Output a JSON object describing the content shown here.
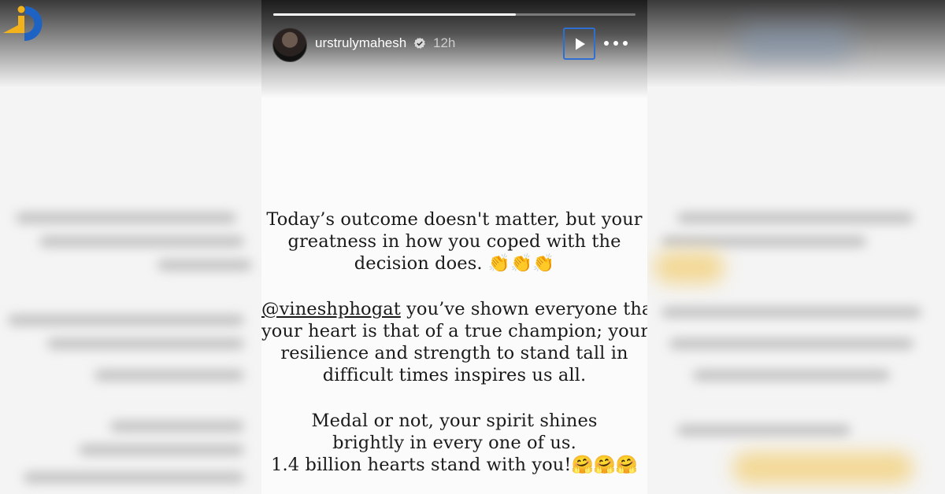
{
  "story": {
    "username": "urstrulymahesh",
    "timestamp": "12h",
    "progress": 0.67,
    "paragraph1": [
      "Today’s outcome doesn't matter, but your",
      "greatness in how you coped with the",
      "decision does. 👏👏👏"
    ],
    "paragraph2": {
      "mention": "@vineshphogat",
      "line1_rest": " you’ve shown everyone that",
      "lines": [
        "your heart is that of a true champion; your",
        "resilience and strength to stand tall in",
        "difficult times inspires us all."
      ]
    },
    "paragraph3": [
      "Medal or not, your spirit shines",
      "brightly in every one of us.",
      "1.4 billion hearts stand with you!🤗🤗🤗"
    ]
  },
  "icons": {
    "logo": "site-logo-icon",
    "verified": "verified-badge-icon",
    "play": "play-icon",
    "more": "more-options-icon"
  },
  "colors": {
    "play_border": "#2f6fd1",
    "logo_blue": "#1e63c4",
    "logo_gold": "#f2b21c"
  }
}
